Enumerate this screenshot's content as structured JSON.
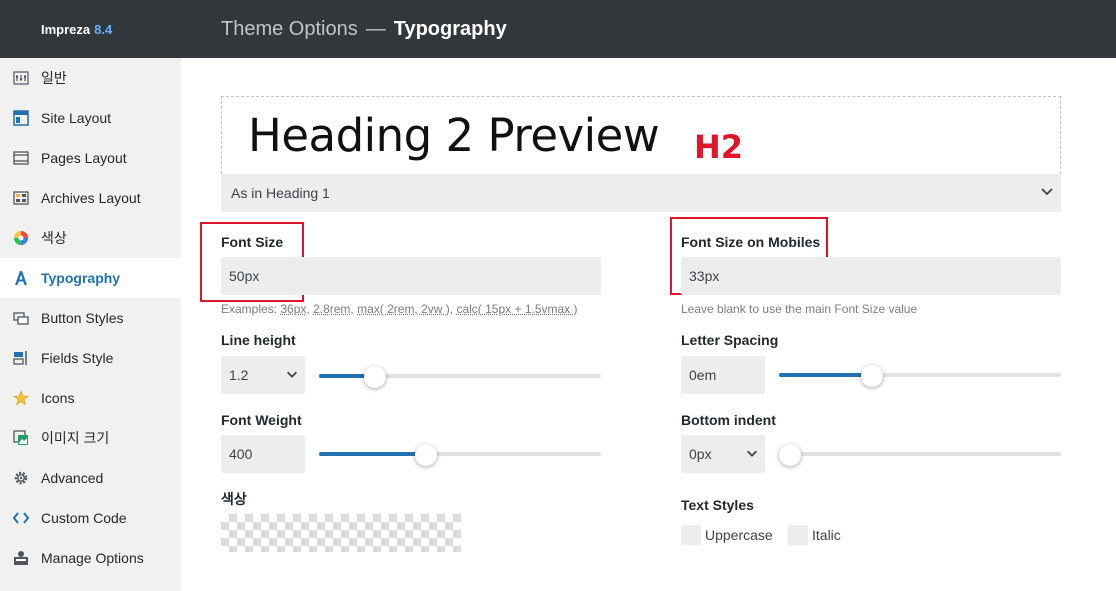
{
  "brand": {
    "name": "Impreza",
    "version": "8.4"
  },
  "header": {
    "section": "Theme Options",
    "separator": "—",
    "page": "Typography"
  },
  "sidebar": {
    "items": [
      {
        "label": "일반",
        "icon": "sliders-icon"
      },
      {
        "label": "Site Layout",
        "icon": "layout-icon"
      },
      {
        "label": "Pages Layout",
        "icon": "page-layout-icon"
      },
      {
        "label": "Archives Layout",
        "icon": "archive-icon"
      },
      {
        "label": "색상",
        "icon": "color-wheel-icon"
      },
      {
        "label": "Typography",
        "icon": "typography-icon",
        "active": true
      },
      {
        "label": "Button Styles",
        "icon": "button-icon"
      },
      {
        "label": "Fields Style",
        "icon": "fields-icon"
      },
      {
        "label": "Icons",
        "icon": "star-icon"
      },
      {
        "label": "이미지 크기",
        "icon": "image-size-icon"
      },
      {
        "label": "Advanced",
        "icon": "gear-icon"
      },
      {
        "label": "Custom Code",
        "icon": "code-icon"
      },
      {
        "label": "Manage Options",
        "icon": "manage-icon"
      }
    ]
  },
  "preview": {
    "text": "Heading 2 Preview",
    "annotation": "H2"
  },
  "font_family": {
    "value": "As in Heading 1"
  },
  "font_size": {
    "label": "Font Size",
    "value": "50px",
    "hint_prefix": "Examples: ",
    "examples": [
      "36px",
      "2.8rem",
      "max( 2rem, 2vw )",
      "calc( 15px + 1.5vmax )"
    ]
  },
  "font_size_mobiles": {
    "label": "Font Size on Mobiles",
    "value": "33px",
    "hint": "Leave blank to use the main Font Size value"
  },
  "line_height": {
    "label": "Line height",
    "value": "1.2",
    "slider_fraction": 0.2
  },
  "letter_spacing": {
    "label": "Letter Spacing",
    "value": "0em",
    "slider_fraction": 0.33
  },
  "font_weight": {
    "label": "Font Weight",
    "value": "400",
    "slider_fraction": 0.38
  },
  "bottom_indent": {
    "label": "Bottom indent",
    "value": "0px",
    "slider_fraction": 0.0
  },
  "color": {
    "label": "색상",
    "value": ""
  },
  "text_styles": {
    "label": "Text Styles",
    "uppercase": "Uppercase",
    "italic": "Italic"
  },
  "colors": {
    "accent": "#2271b1",
    "annotation": "#e0142a",
    "header_bg": "#32373c"
  }
}
